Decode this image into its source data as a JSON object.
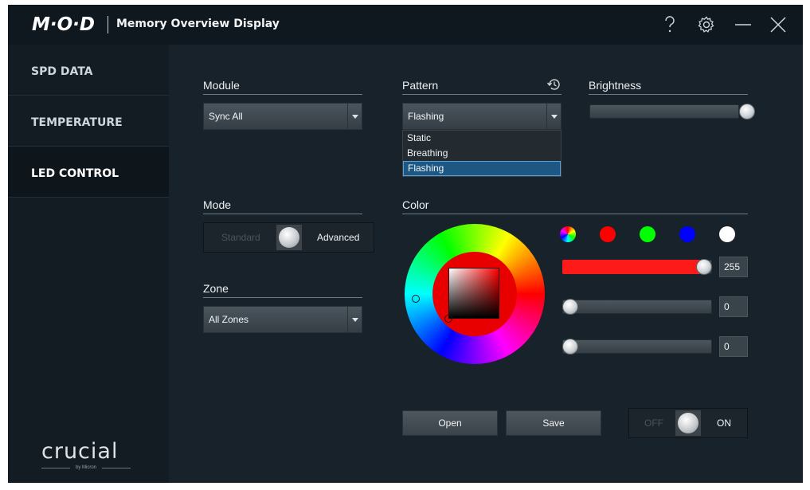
{
  "app": {
    "logo": "M·O·D",
    "title": "Memory Overview Display"
  },
  "window_controls": [
    "help-icon",
    "settings-gear-icon",
    "minimize-icon",
    "close-icon"
  ],
  "sidebar": {
    "items": [
      {
        "label": "SPD DATA",
        "active": false
      },
      {
        "label": "TEMPERATURE",
        "active": false
      },
      {
        "label": "LED CONTROL",
        "active": true
      }
    ],
    "brand": "crucial",
    "brand_sub": "by Micron"
  },
  "module": {
    "heading": "Module",
    "value": "Sync All"
  },
  "pattern": {
    "heading": "Pattern",
    "value": "Flashing",
    "options": [
      "Static",
      "Breathing",
      "Flashing"
    ],
    "selected_index": 2
  },
  "brightness": {
    "heading": "Brightness",
    "level": 1.0
  },
  "mode": {
    "heading": "Mode",
    "off_label": "Standard",
    "on_label": "Advanced",
    "state": "Advanced"
  },
  "zone": {
    "heading": "Zone",
    "value": "All Zones"
  },
  "color": {
    "heading": "Color",
    "presets": [
      {
        "name": "rainbow",
        "color": "conic"
      },
      {
        "name": "red",
        "color": "#ff0000"
      },
      {
        "name": "green",
        "color": "#00ff00"
      },
      {
        "name": "blue",
        "color": "#0000ff"
      },
      {
        "name": "white",
        "color": "#ffffff"
      }
    ],
    "selected_hex": "#ff0000",
    "channels": [
      {
        "name": "red",
        "value": "255",
        "fill": "#ff1a1a"
      },
      {
        "name": "green",
        "value": "0",
        "fill": ""
      },
      {
        "name": "blue",
        "value": "0",
        "fill": ""
      }
    ]
  },
  "actions": {
    "open_label": "Open",
    "save_label": "Save"
  },
  "power": {
    "off_label": "OFF",
    "on_label": "ON",
    "state": "ON"
  },
  "colors": {
    "accent_selected": "#1d5885",
    "background": "#17222a"
  }
}
